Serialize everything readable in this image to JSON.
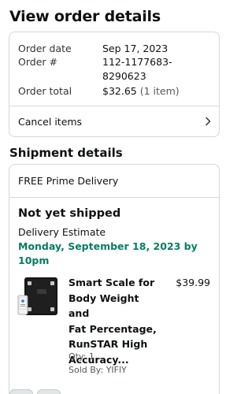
{
  "page": {
    "title": "View order details"
  },
  "summary": {
    "order_date_label": "Order date",
    "order_date": "Sep 17, 2023",
    "order_number_label": "Order #",
    "order_number_line1": "112-1177683-",
    "order_number_line2": "8290623",
    "order_total_label": "Order total",
    "order_total": "$32.65",
    "order_items": "(1 item)",
    "cancel_label": "Cancel items"
  },
  "shipment": {
    "section_title": "Shipment details",
    "delivery_type": "FREE Prime Delivery",
    "status": "Not yet shipped",
    "estimate_label": "Delivery Estimate",
    "estimate_line1": "Monday, September 18, 2023 by",
    "estimate_line2": "10pm",
    "accent_color": "#067d62"
  },
  "product": {
    "title_lines": [
      "Smart Scale for",
      "Body Weight and",
      "Fat Percentage,",
      "RunSTAR High",
      "Accuracy..."
    ],
    "price": "$39.99",
    "qty": "Qty: 1",
    "seller": "Sold By: YIFlY"
  }
}
